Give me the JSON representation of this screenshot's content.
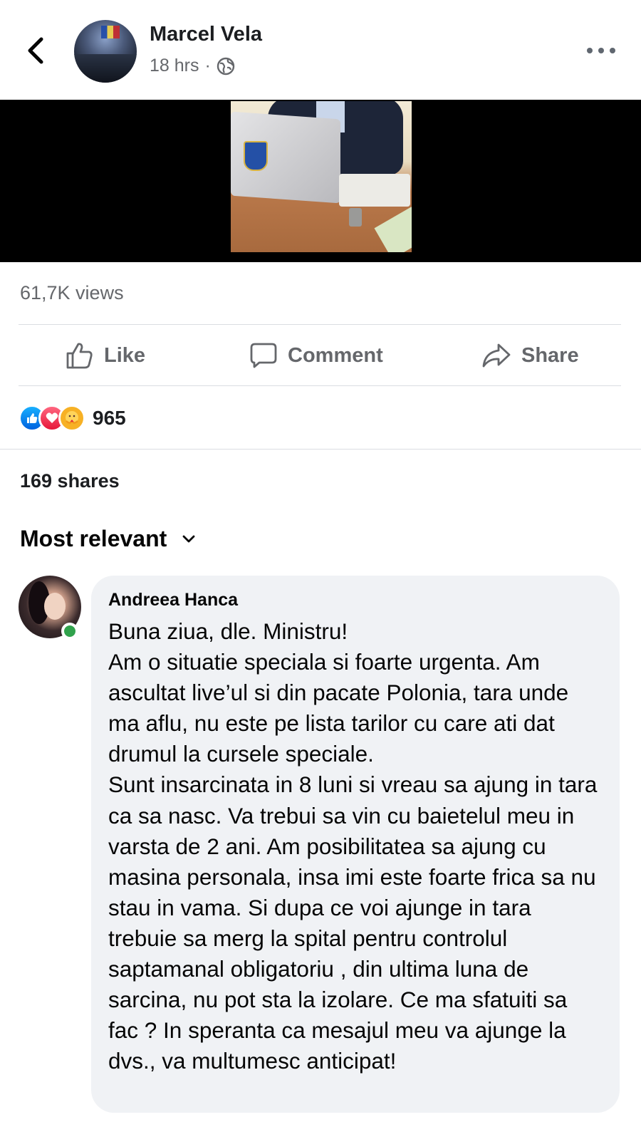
{
  "header": {
    "author_name": "Marcel Vela",
    "time": "18 hrs",
    "separator": "·",
    "privacy_icon": "globe-icon",
    "back_icon": "chevron-left-icon",
    "more_icon": "more-dots-icon"
  },
  "video": {
    "kind": "video-thumbnail"
  },
  "stats": {
    "views": "61,7K views",
    "reaction_count": "965",
    "reactions": [
      "like",
      "love",
      "care"
    ],
    "shares": "169 shares"
  },
  "actions": {
    "like": "Like",
    "comment": "Comment",
    "share": "Share"
  },
  "comments_sort": {
    "label": "Most relevant",
    "icon": "chevron-down-icon"
  },
  "comment": {
    "author": "Andreea Hanca",
    "online": true,
    "text": "Buna ziua, dle. Ministru!\nAm o situatie speciala si foarte urgenta. Am ascultat live’ul si din pacate Polonia, tara unde ma aflu, nu este pe lista tarilor cu care ati dat drumul la cursele speciale.\nSunt insarcinata in 8 luni si vreau sa ajung in tara ca sa nasc. Va trebui sa vin cu baietelul meu in varsta de 2 ani. Am posibilitatea sa ajung cu masina personala, insa imi este foarte frica sa nu stau in vama. Si dupa ce voi ajunge in tara trebuie sa merg la spital pentru controlul saptamanal obligatoriu , din ultima luna de sarcina, nu pot sta la izolare. Ce ma sfatuiti sa fac ? In speranta ca mesajul meu va ajunge la dvs., va multumesc anticipat!"
  },
  "colors": {
    "secondary_text": "#65676b",
    "bubble": "#f0f2f5",
    "online": "#31a24c",
    "like_blue": "#0062df",
    "love_red": "#e61739"
  }
}
